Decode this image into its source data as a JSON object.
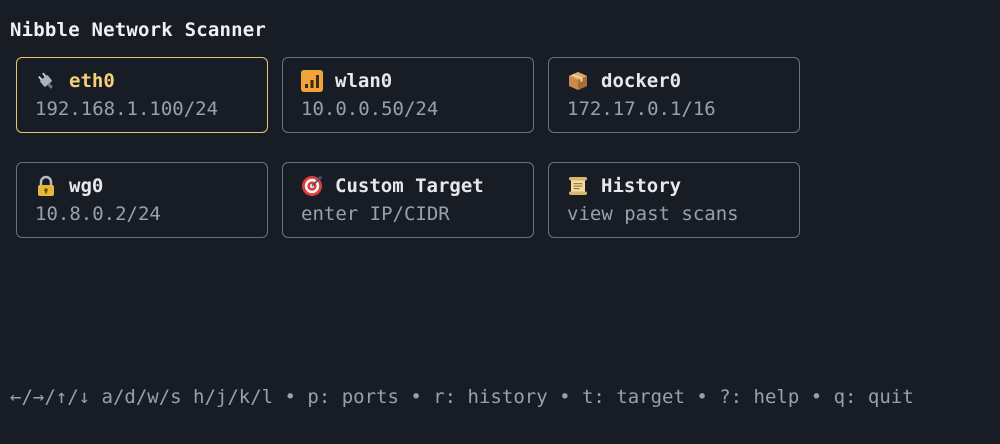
{
  "app": {
    "title": "Nibble Network Scanner"
  },
  "cards": [
    {
      "name": "eth0",
      "detail": "192.168.1.100/24",
      "icon": "plug-icon",
      "selected": true
    },
    {
      "name": "wlan0",
      "detail": "10.0.0.50/24",
      "icon": "signal-bars-icon",
      "selected": false
    },
    {
      "name": "docker0",
      "detail": "172.17.0.1/16",
      "icon": "package-icon",
      "selected": false
    },
    {
      "name": "wg0",
      "detail": "10.8.0.2/24",
      "icon": "lock-icon",
      "selected": false
    },
    {
      "name": "Custom Target",
      "detail": "enter IP/CIDR",
      "icon": "target-icon",
      "selected": false
    },
    {
      "name": "History",
      "detail": "view past scans",
      "icon": "scroll-icon",
      "selected": false
    }
  ],
  "footer": {
    "help_text": "←/→/↑/↓ a/d/w/s h/j/k/l • p: ports • r: history • t: target • ?: help • q: quit"
  },
  "colors": {
    "background": "#181d25",
    "card_border": "#6b7079",
    "selected_border": "#e8c56a",
    "selected_text": "#f5d27a",
    "muted_text": "#9aa0a9"
  }
}
